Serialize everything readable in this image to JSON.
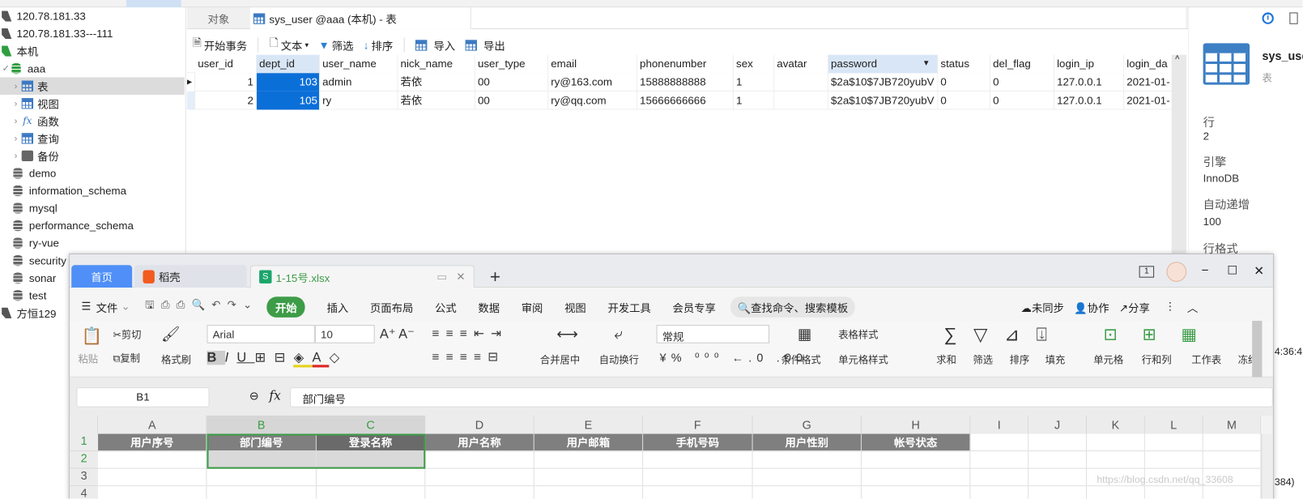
{
  "sidebar": {
    "items": [
      {
        "label": "120.78.181.33",
        "icon": "connection-icon"
      },
      {
        "label": "120.78.181.33---111",
        "icon": "connection-icon"
      },
      {
        "label": "本机",
        "icon": "connection-icon"
      },
      {
        "label": "aaa",
        "icon": "database-icon"
      },
      {
        "label": "表",
        "icon": "table-icon"
      },
      {
        "label": "视图",
        "icon": "view-icon"
      },
      {
        "label": "函数",
        "icon": "function-icon"
      },
      {
        "label": "查询",
        "icon": "query-icon"
      },
      {
        "label": "备份",
        "icon": "backup-icon"
      },
      {
        "label": "demo",
        "icon": "database-icon"
      },
      {
        "label": "information_schema",
        "icon": "database-icon"
      },
      {
        "label": "mysql",
        "icon": "database-icon"
      },
      {
        "label": "performance_schema",
        "icon": "database-icon"
      },
      {
        "label": "ry-vue",
        "icon": "database-icon"
      },
      {
        "label": "security",
        "icon": "database-icon"
      },
      {
        "label": "sonar",
        "icon": "database-icon"
      },
      {
        "label": "test",
        "icon": "database-icon"
      },
      {
        "label": "方恒129",
        "icon": "connection-icon"
      }
    ]
  },
  "navicat": {
    "tabs": {
      "objects": "对象",
      "active": "sys_user @aaa (本机) - 表"
    },
    "toolbar": {
      "begin_tx": "开始事务",
      "text": "文本",
      "filter": "筛选",
      "sort": "排序",
      "import": "导入",
      "export": "导出"
    },
    "columns": [
      "user_id",
      "dept_id",
      "user_name",
      "nick_name",
      "user_type",
      "email",
      "phonenumber",
      "sex",
      "avatar",
      "password",
      "status",
      "del_flag",
      "login_ip",
      "login_da"
    ],
    "rows": [
      [
        "1",
        "103",
        "admin",
        "若依",
        "00",
        "ry@163.com",
        "15888888888",
        "1",
        "",
        "$2a$10$7JB720yubV",
        "0",
        "0",
        "127.0.0.1",
        "2021-01-"
      ],
      [
        "2",
        "105",
        "ry",
        "若依",
        "00",
        "ry@qq.com",
        "15666666666",
        "1",
        "",
        "$2a$10$7JB720yubV",
        "0",
        "0",
        "127.0.0.1",
        "2021-01-"
      ]
    ],
    "selection_color": "#0b6fd8"
  },
  "info_panel": {
    "name": "sys_use",
    "type": "表",
    "rows_label": "行",
    "rows": "2",
    "engine_label": "引擎",
    "engine": "InnoDB",
    "auto_inc_label": "自动递增",
    "auto_inc": "100",
    "row_format_label": "行格式"
  },
  "wps": {
    "tabs": {
      "home": "首页",
      "docer": "稻壳",
      "file": "1-15号.xlsx",
      "add": "+"
    },
    "window_badge": "1",
    "menu": {
      "file": "文件",
      "tabs": [
        "开始",
        "插入",
        "页面布局",
        "公式",
        "数据",
        "审阅",
        "视图",
        "开发工具",
        "会员专享"
      ],
      "search_placeholder": "查找命令、搜索模板",
      "unsynced": "未同步",
      "collab": "协作",
      "share": "分享"
    },
    "ribbon": {
      "paste": "粘贴",
      "cut": "剪切",
      "copy": "复制",
      "format_painter": "格式刷",
      "font": "Arial",
      "size": "10",
      "merge_center": "合并居中",
      "wrap": "自动换行",
      "number_format": "常规",
      "cond_format": "条件格式",
      "table_style": "表格样式",
      "cell_style": "单元格样式",
      "sum": "求和",
      "filter": "筛选",
      "sort": "排序",
      "fill": "填充",
      "cells": "单元格",
      "rows_cols": "行和列",
      "worksheet": "工作表",
      "freeze": "冻结"
    },
    "name_box": "B1",
    "formula": "部门编号",
    "col_headers": [
      "A",
      "B",
      "C",
      "D",
      "E",
      "F",
      "G",
      "H",
      "I",
      "J",
      "K",
      "L",
      "M"
    ],
    "row_headers": [
      "1",
      "2",
      "3",
      "4"
    ],
    "row1": [
      "用户序号",
      "部门编号",
      "登录名称",
      "用户名称",
      "用户邮箱",
      "手机号码",
      "用户性别",
      "帐号状态"
    ],
    "accent": "#3d9c47"
  },
  "overlay": {
    "time_fragment": "4:36:4",
    "watermark": "https://blog.csdn.net/qq_33608",
    "suffix": "384)"
  }
}
